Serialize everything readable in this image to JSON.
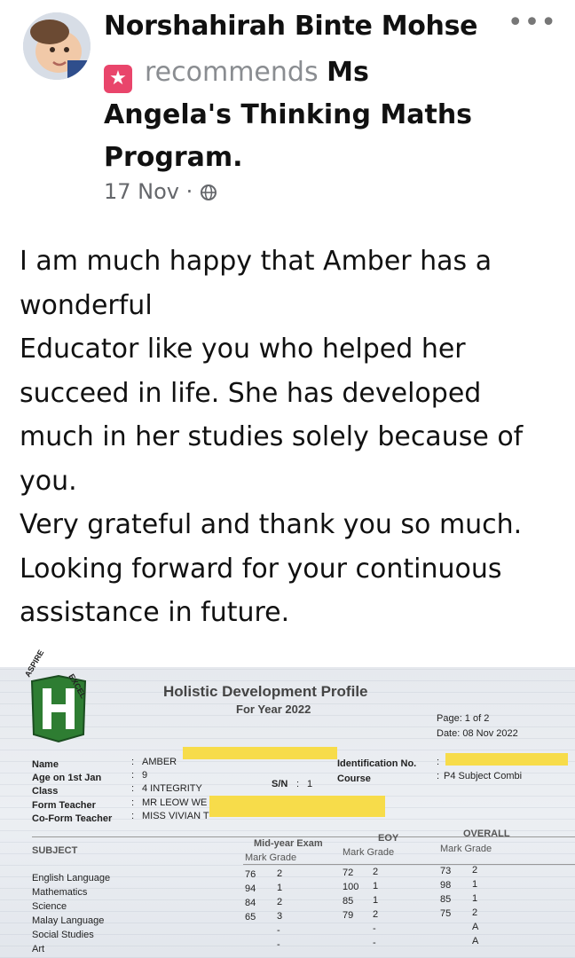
{
  "post": {
    "author": "Norshahirah Binte Mohse",
    "more_glyph": "•••",
    "recommends_word": "recommends",
    "page_name_inline": "Ms",
    "page_name_rest": "Angela's Thinking Maths Program.",
    "date": "17 Nov",
    "dot": "·",
    "audience_icon": "globe-icon",
    "body": "I am much happy that Amber has a wonderful\nEducator like you who helped her succeed in life. She has developed much in her studies solely because of you.\nVery grateful and thank you so much. Looking forward for your continuous assistance in future.",
    "accent_color": "#e9456b"
  },
  "report": {
    "title": "Holistic Development Profile",
    "subtitle": "For Year 2022",
    "crest_text_left": "ASPIRE",
    "crest_text_right": "EXCEL",
    "page_label": "Page: 1",
    "page_of": "of  2",
    "date_label": "Date: 08 Nov 2022",
    "fields": {
      "name_label": "Name",
      "name_value": "AMBER",
      "age_label": "Age on 1st Jan",
      "age_value": "9",
      "class_label": "Class",
      "class_value": "4 INTEGRITY",
      "sn_label": "S/N",
      "sn_value": "1",
      "form_teacher_label": "Form Teacher",
      "form_teacher_value": "MR LEOW WE",
      "coform_teacher_label": "Co-Form Teacher",
      "coform_teacher_value": "MISS VIVIAN T",
      "id_label": "Identification No.",
      "course_label": "Course",
      "course_value": "P4 Subject Combi",
      "colon": ":"
    },
    "table": {
      "subject_header": "SUBJECT",
      "midyear_header": "Mid-year Exam",
      "eoy_header": "EOY",
      "overall_header": "OVERALL",
      "sub_header": "Mark Grade",
      "rows": [
        {
          "subject": "English Language",
          "mid_mark": "76",
          "mid_grade": "2",
          "eoy_mark": "72",
          "eoy_grade": "2",
          "ov_mark": "73",
          "ov_grade": "2"
        },
        {
          "subject": "Mathematics",
          "mid_mark": "94",
          "mid_grade": "1",
          "eoy_mark": "100",
          "eoy_grade": "1",
          "ov_mark": "98",
          "ov_grade": "1"
        },
        {
          "subject": "Science",
          "mid_mark": "84",
          "mid_grade": "2",
          "eoy_mark": "85",
          "eoy_grade": "1",
          "ov_mark": "85",
          "ov_grade": "1"
        },
        {
          "subject": "Malay Language",
          "mid_mark": "65",
          "mid_grade": "3",
          "eoy_mark": "79",
          "eoy_grade": "2",
          "ov_mark": "75",
          "ov_grade": "2"
        },
        {
          "subject": "Social Studies",
          "mid_mark": "",
          "mid_grade": "-",
          "eoy_mark": "",
          "eoy_grade": "-",
          "ov_mark": "",
          "ov_grade": "A"
        },
        {
          "subject": "Art",
          "mid_mark": "",
          "mid_grade": "-",
          "eoy_mark": "",
          "eoy_grade": "-",
          "ov_mark": "",
          "ov_grade": "A"
        }
      ]
    },
    "redaction_color": "#f7dc4a"
  }
}
